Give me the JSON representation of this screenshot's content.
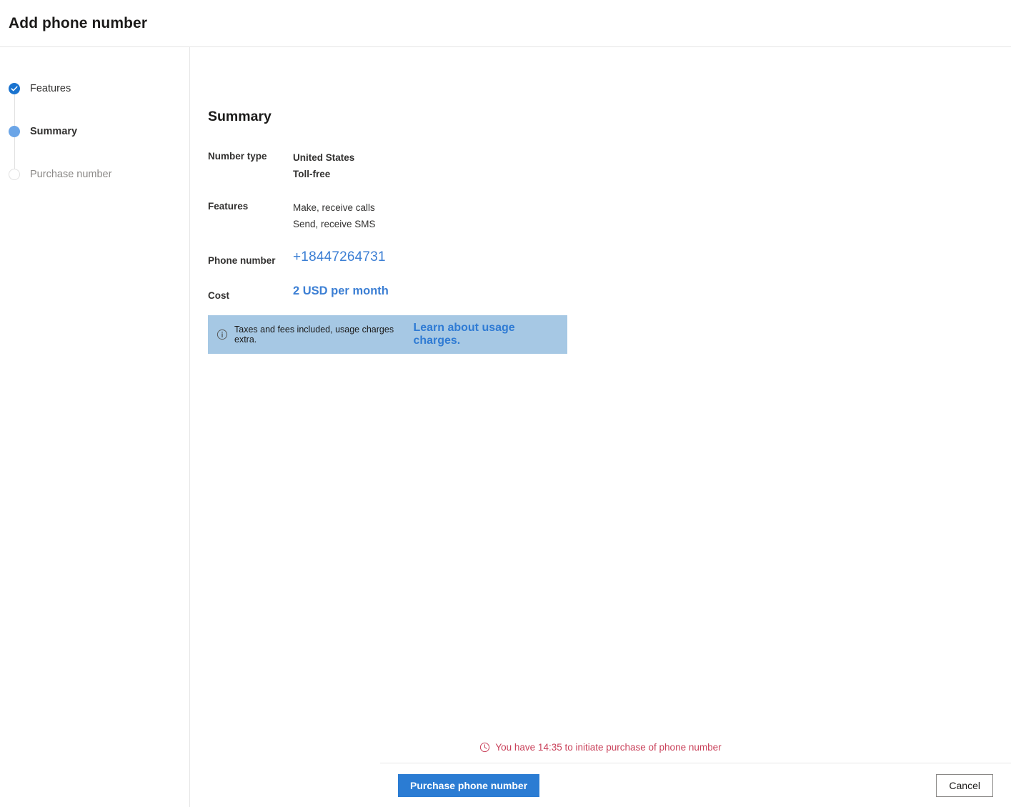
{
  "header": {
    "title": "Add phone number"
  },
  "stepper": {
    "steps": [
      {
        "label": "Features",
        "state": "done",
        "icon": "check-icon"
      },
      {
        "label": "Summary",
        "state": "current",
        "icon": "filled-circle-icon"
      },
      {
        "label": "Purchase number",
        "state": "pending",
        "icon": "empty-circle-icon"
      }
    ]
  },
  "main": {
    "title": "Summary",
    "rows": [
      {
        "label": "Number type",
        "lines": [
          "United States",
          "Toll-free"
        ],
        "style": "bold"
      },
      {
        "label": "Features",
        "lines": [
          "Make, receive calls",
          "Send, receive SMS"
        ],
        "style": "normal"
      }
    ],
    "phone": {
      "label": "Phone number",
      "value": "+18447264731"
    },
    "cost": {
      "label": "Cost",
      "value": "2 USD per month"
    },
    "info_banner": {
      "icon": "info-circle-icon",
      "text": "Taxes and fees included, usage charges extra.",
      "link_text": "Learn about usage charges.",
      "background": "#a6c8e4",
      "link_color": "#2f7bd4"
    },
    "timer": {
      "icon": "clock-icon",
      "text": "You have 14:35 to initiate purchase of phone number",
      "color": "#c9415a"
    }
  },
  "footer": {
    "primary_button": "Purchase phone number",
    "secondary_button": "Cancel",
    "primary_color": "#2b7cd3"
  }
}
